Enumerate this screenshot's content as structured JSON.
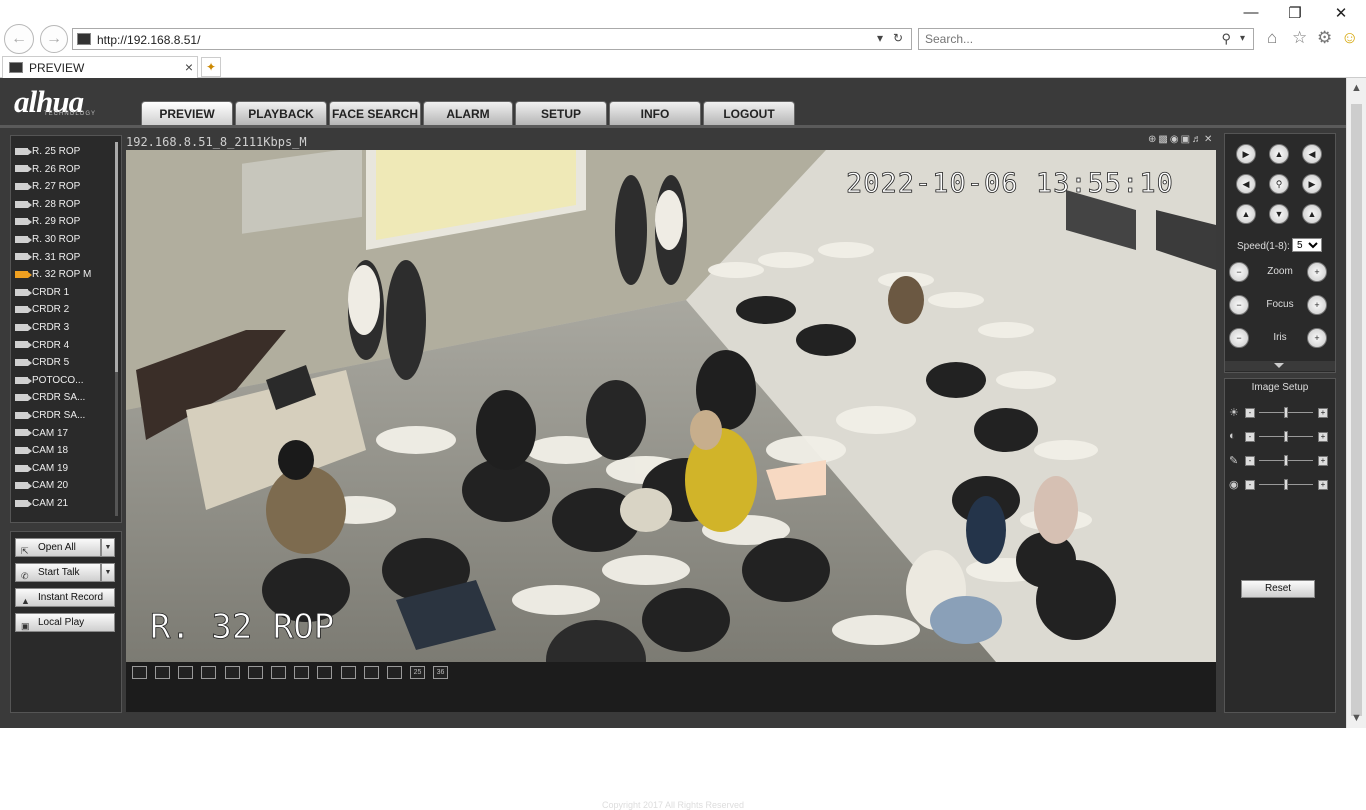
{
  "browser": {
    "address": "http://192.168.8.51/",
    "search_placeholder": "Search...",
    "tab_title": "PREVIEW"
  },
  "app": {
    "logo_text": "alhua",
    "logo_sub": "TECHNOLOGY",
    "tabs": [
      "PREVIEW",
      "PLAYBACK",
      "FACE SEARCH",
      "ALARM",
      "SETUP",
      "INFO",
      "LOGOUT"
    ],
    "active_tab": "PREVIEW"
  },
  "channels": [
    {
      "label": "R. 25 ROP"
    },
    {
      "label": "R. 26 ROP"
    },
    {
      "label": "R. 27 ROP"
    },
    {
      "label": "R. 28 ROP"
    },
    {
      "label": "R. 29 ROP"
    },
    {
      "label": "R. 30 ROP"
    },
    {
      "label": "R. 31 ROP"
    },
    {
      "label": "R. 32 ROP   M",
      "active": true
    },
    {
      "label": "CRDR 1"
    },
    {
      "label": "CRDR 2"
    },
    {
      "label": "CRDR 3"
    },
    {
      "label": "CRDR 4"
    },
    {
      "label": "CRDR 5"
    },
    {
      "label": "POTOCO..."
    },
    {
      "label": "CRDR SA..."
    },
    {
      "label": "CRDR SA..."
    },
    {
      "label": "CAM 17"
    },
    {
      "label": "CAM 18"
    },
    {
      "label": "CAM 19"
    },
    {
      "label": "CAM 20"
    },
    {
      "label": "CAM 21"
    }
  ],
  "controls": {
    "open_all": "Open All",
    "start_talk": "Start Talk",
    "instant_record": "Instant Record",
    "local_play": "Local Play"
  },
  "video": {
    "stream_title": "192.168.8.51_8_2111Kbps_M",
    "timestamp": "2022-10-06 13:55:10",
    "camera_label": "R. 32 ROP"
  },
  "layouts": [
    "",
    "",
    "",
    "",
    "",
    "",
    "",
    "",
    "",
    "",
    "",
    "",
    "",
    "25",
    "36"
  ],
  "ptz": {
    "speed_label": "Speed(1-8):",
    "speed_value": "5",
    "zoom_label": "Zoom",
    "focus_label": "Focus",
    "iris_label": "Iris"
  },
  "image_setup": {
    "title": "Image Setup",
    "reset_label": "Reset",
    "settings": [
      {
        "icon": "brightness-icon",
        "level": 0.5
      },
      {
        "icon": "contrast-icon",
        "level": 0.5
      },
      {
        "icon": "saturation-icon",
        "level": 0.5
      },
      {
        "icon": "hue-icon",
        "level": 0.5
      }
    ]
  },
  "footer_text": "Copyright 2017 All Rights Reserved"
}
